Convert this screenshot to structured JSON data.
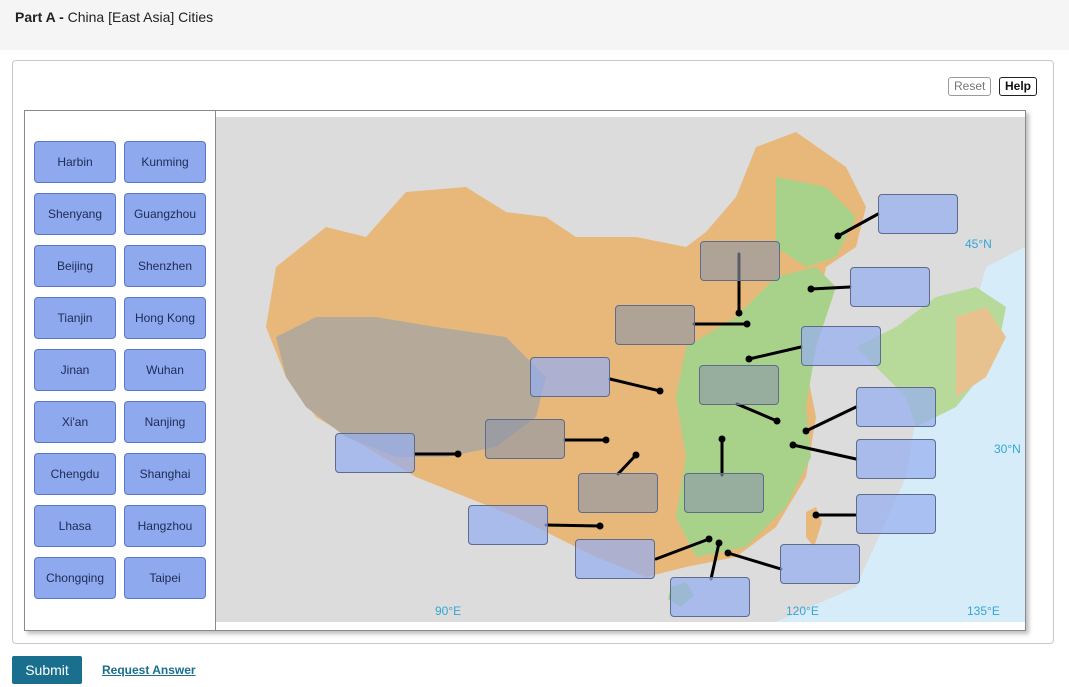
{
  "header": {
    "part": "Part A -",
    "title": "China [East Asia] Cities"
  },
  "toolbar": {
    "reset_label": "Reset",
    "help_label": "Help"
  },
  "label_bank": [
    "Harbin",
    "Kunming",
    "Shenyang",
    "Guangzhou",
    "Beijing",
    "Shenzhen",
    "Tianjin",
    "Hong Kong",
    "Jinan",
    "Wuhan",
    "Xi'an",
    "Nanjing",
    "Chengdu",
    "Shanghai",
    "Lhasa",
    "Hangzhou",
    "Chongqing",
    "Taipei"
  ],
  "map": {
    "latitude_labels": [
      "45°N",
      "30°N"
    ],
    "longitude_labels": [
      "90°E",
      "120°E",
      "135°E"
    ],
    "colors": {
      "ocean": "#d6ecf8",
      "lowland": "#a8d28a",
      "upland": "#e8b87a",
      "plateau": "#b5a99a",
      "neighbor": "#dcdcdc"
    }
  },
  "actions": {
    "submit_label": "Submit",
    "request_label": "Request Answer"
  }
}
